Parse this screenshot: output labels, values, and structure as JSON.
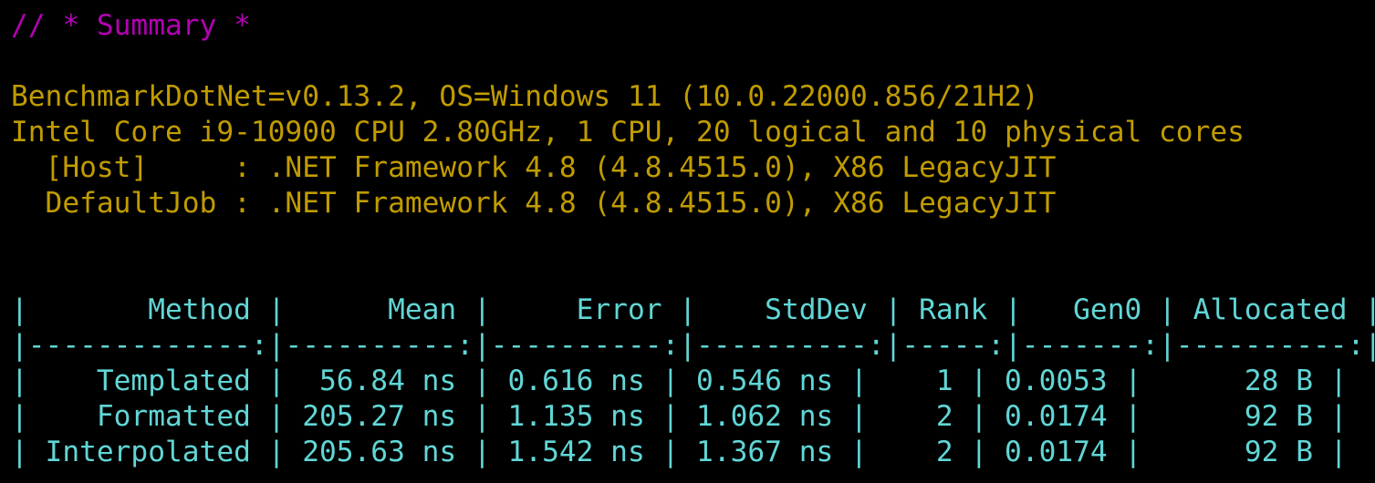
{
  "terminal": {
    "colors": {
      "background": "#000000",
      "summary_heading": "#b400b4",
      "environment_text": "#c19c00",
      "table_text": "#61d6d6"
    },
    "summary_heading": "// * Summary *",
    "environment": [
      "BenchmarkDotNet=v0.13.2, OS=Windows 11 (10.0.22000.856/21H2)",
      "Intel Core i9-10900 CPU 2.80GHz, 1 CPU, 20 logical and 10 physical cores",
      "  [Host]     : .NET Framework 4.8 (4.8.4515.0), X86 LegacyJIT",
      "  DefaultJob : .NET Framework 4.8 (4.8.4515.0), X86 LegacyJIT"
    ],
    "table": {
      "header": "|       Method |      Mean |     Error |    StdDev | Rank |   Gen0 | Allocated |",
      "separator": "|-------------:|----------:|----------:|----------:|-----:|-------:|----------:|",
      "rows": [
        "|    Templated |  56.84 ns | 0.616 ns | 0.546 ns |    1 | 0.0053 |      28 B |",
        "|    Formatted | 205.27 ns | 1.135 ns | 1.062 ns |    2 | 0.0174 |      92 B |",
        "| Interpolated | 205.63 ns | 1.542 ns | 1.367 ns |    2 | 0.0174 |      92 B |"
      ]
    }
  }
}
